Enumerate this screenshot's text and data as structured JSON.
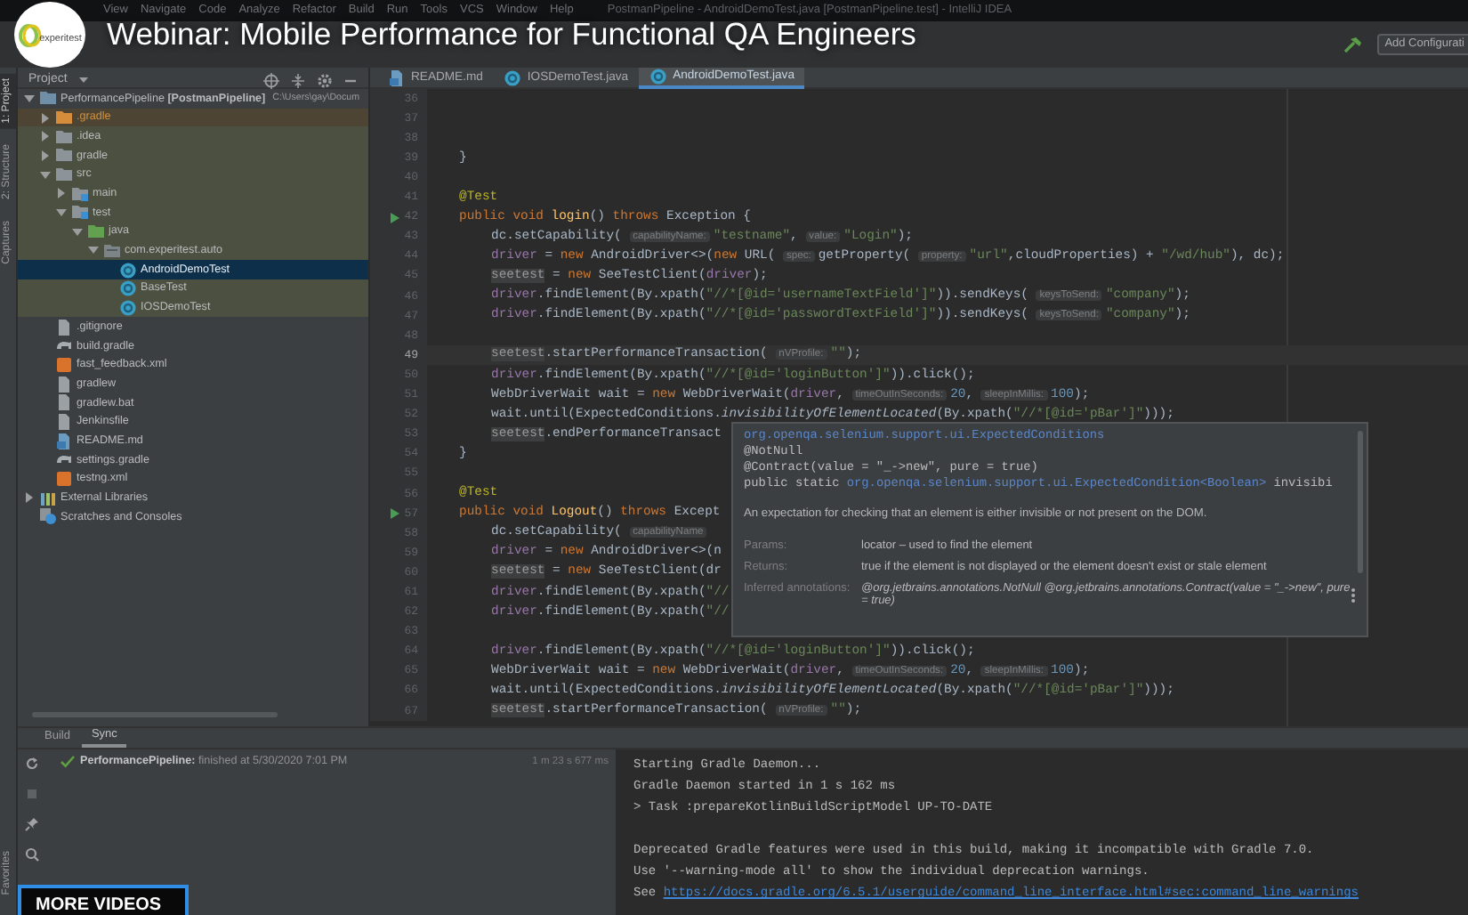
{
  "video_title": "Webinar: Mobile Performance for Functional QA Engineers",
  "channel_logo": {
    "text": "experitest"
  },
  "more_videos": "MORE VIDEOS",
  "ide": {
    "menu": [
      "View",
      "Navigate",
      "Code",
      "Analyze",
      "Refactor",
      "Build",
      "Run",
      "Tools",
      "VCS",
      "Window",
      "Help"
    ],
    "window_title": "PostmanPipeline - AndroidDemoTest.java [PostmanPipeline.test] - IntelliJ IDEA",
    "run_config": "Add Configurati",
    "side_tabs": [
      {
        "label": "1: Project",
        "selected": true
      },
      {
        "label": "2: Structure",
        "selected": false
      },
      {
        "label": "Captures",
        "selected": false
      }
    ],
    "bottom_side_tab": "Favorites",
    "project": {
      "title": "Project",
      "tree": [
        {
          "label": "PerformancePipeline **[PostmanPipeline]**",
          "path": "C:\\Users\\gay\\Docum",
          "kind": "module",
          "selected": false,
          "highlighted": false,
          "expanded": true,
          "children": [
            {
              "label": ".gradle",
              "kind": "excluded",
              "selected": false,
              "highlighted": true,
              "expanded": false
            },
            {
              "label": ".idea",
              "kind": "folder",
              "selected": false,
              "highlighted": true,
              "expanded": false
            },
            {
              "label": "gradle",
              "kind": "folder",
              "selected": false,
              "highlighted": true,
              "expanded": false
            },
            {
              "label": "src",
              "kind": "folder",
              "selected": false,
              "highlighted": true,
              "expanded": true,
              "children": [
                {
                  "label": "main",
                  "kind": "source",
                  "selected": false,
                  "highlighted": true,
                  "expanded": false
                },
                {
                  "label": "test",
                  "kind": "source",
                  "selected": false,
                  "highlighted": true,
                  "expanded": true,
                  "children": [
                    {
                      "label": "java",
                      "kind": "test-root",
                      "selected": false,
                      "highlighted": true,
                      "expanded": true,
                      "children": [
                        {
                          "label": "com.experitest.auto",
                          "kind": "package",
                          "selected": false,
                          "highlighted": true,
                          "expanded": true,
                          "children": [
                            {
                              "label": "AndroidDemoTest",
                              "kind": "class",
                              "selected": true,
                              "highlighted": true
                            },
                            {
                              "label": "BaseTest",
                              "kind": "class",
                              "selected": false,
                              "highlighted": true
                            },
                            {
                              "label": "IOSDemoTest",
                              "kind": "class",
                              "selected": false,
                              "highlighted": true
                            }
                          ]
                        }
                      ]
                    }
                  ]
                }
              ]
            },
            {
              "label": ".gitignore",
              "kind": "file",
              "selected": false,
              "highlighted": false
            },
            {
              "label": "build.gradle",
              "kind": "gradle",
              "selected": false,
              "highlighted": false
            },
            {
              "label": "fast_feedback.xml",
              "kind": "xml",
              "selected": false,
              "highlighted": false
            },
            {
              "label": "gradlew",
              "kind": "file",
              "selected": false,
              "highlighted": false
            },
            {
              "label": "gradlew.bat",
              "kind": "file",
              "selected": false,
              "highlighted": false
            },
            {
              "label": "Jenkinsfile",
              "kind": "file",
              "selected": false,
              "highlighted": false
            },
            {
              "label": "README.md",
              "kind": "markdown",
              "selected": false,
              "highlighted": false
            },
            {
              "label": "settings.gradle",
              "kind": "gradle",
              "selected": false,
              "highlighted": false
            },
            {
              "label": "testng.xml",
              "kind": "xml",
              "selected": false,
              "highlighted": false
            }
          ]
        },
        {
          "label": "External Libraries",
          "kind": "library",
          "selected": false,
          "highlighted": false,
          "expanded": false
        },
        {
          "label": "Scratches and Consoles",
          "kind": "scratch",
          "selected": false,
          "highlighted": false
        }
      ]
    },
    "tabs": [
      {
        "label": "README.md",
        "kind": "markdown",
        "selected": false
      },
      {
        "label": "IOSDemoTest.java",
        "kind": "class",
        "selected": false
      },
      {
        "label": "AndroidDemoTest.java",
        "kind": "class",
        "selected": true
      }
    ],
    "lines": [
      {
        "number": "36",
        "kind": "blank",
        "run_marker": false,
        "current": false
      },
      {
        "number": "37",
        "kind": "blank",
        "run_marker": false,
        "current": false
      },
      {
        "number": "38",
        "kind": "blank",
        "run_marker": false,
        "current": false
      },
      {
        "number": "39",
        "kind": "member",
        "run_marker": false,
        "current": false,
        "code": [
          {
            "kind": "plain",
            "text": "}"
          }
        ]
      },
      {
        "number": "40",
        "kind": "blank",
        "run_marker": false,
        "current": false
      },
      {
        "number": "41",
        "kind": "member",
        "run_marker": false,
        "current": false,
        "code": [
          {
            "kind": "annotation",
            "text": "@Test"
          }
        ]
      },
      {
        "number": "42",
        "kind": "member",
        "run_marker": true,
        "current": false,
        "code": [
          {
            "kind": "keyword",
            "text": "public void "
          },
          {
            "kind": "declaration",
            "text": "login"
          },
          {
            "kind": "plain",
            "text": "() "
          },
          {
            "kind": "keyword",
            "text": "throws "
          },
          {
            "kind": "plain",
            "text": "Exception {"
          }
        ]
      },
      {
        "number": "43",
        "kind": "statement",
        "run_marker": false,
        "current": false,
        "code": [
          {
            "kind": "plain",
            "text": "dc.setCapability( "
          },
          {
            "kind": "hint",
            "text": "capabilityName:"
          },
          {
            "kind": "string",
            "text": "\"testname\""
          },
          {
            "kind": "plain",
            "text": ", "
          },
          {
            "kind": "hint",
            "text": "value:"
          },
          {
            "kind": "string",
            "text": "\"Login\""
          },
          {
            "kind": "plain",
            "text": ");"
          }
        ]
      },
      {
        "number": "44",
        "kind": "statement",
        "run_marker": false,
        "current": false,
        "code": [
          {
            "kind": "field",
            "text": "driver"
          },
          {
            "kind": "plain",
            "text": " = "
          },
          {
            "kind": "keyword",
            "text": "new "
          },
          {
            "kind": "plain",
            "text": "AndroidDriver<>("
          },
          {
            "kind": "keyword",
            "text": "new "
          },
          {
            "kind": "plain",
            "text": "URL( "
          },
          {
            "kind": "hint",
            "text": "spec:"
          },
          {
            "kind": "plain",
            "text": "getProperty( "
          },
          {
            "kind": "hint",
            "text": "property:"
          },
          {
            "kind": "string",
            "text": "\"url\""
          },
          {
            "kind": "plain",
            "text": ",cloudProperties) + "
          },
          {
            "kind": "string",
            "text": "\"/wd/hub\""
          },
          {
            "kind": "plain",
            "text": "), dc);"
          }
        ]
      },
      {
        "number": "45",
        "kind": "statement",
        "run_marker": false,
        "current": false,
        "code": [
          {
            "kind": "unused",
            "text": "seetest"
          },
          {
            "kind": "plain",
            "text": " = "
          },
          {
            "kind": "keyword",
            "text": "new "
          },
          {
            "kind": "plain",
            "text": "SeeTestClient("
          },
          {
            "kind": "field",
            "text": "driver"
          },
          {
            "kind": "plain",
            "text": ");"
          }
        ]
      },
      {
        "number": "46",
        "kind": "statement",
        "run_marker": false,
        "current": false,
        "code": [
          {
            "kind": "field",
            "text": "driver"
          },
          {
            "kind": "plain",
            "text": ".findElement(By.xpath("
          },
          {
            "kind": "string",
            "text": "\"//*[@id='usernameTextField']\""
          },
          {
            "kind": "plain",
            "text": ")).sendKeys( "
          },
          {
            "kind": "hint",
            "text": "keysToSend:"
          },
          {
            "kind": "string",
            "text": "\"company\""
          },
          {
            "kind": "plain",
            "text": ");"
          }
        ]
      },
      {
        "number": "47",
        "kind": "statement",
        "run_marker": false,
        "current": false,
        "code": [
          {
            "kind": "field",
            "text": "driver"
          },
          {
            "kind": "plain",
            "text": ".findElement(By.xpath("
          },
          {
            "kind": "string",
            "text": "\"//*[@id='passwordTextField']\""
          },
          {
            "kind": "plain",
            "text": ")).sendKeys( "
          },
          {
            "kind": "hint",
            "text": "keysToSend:"
          },
          {
            "kind": "string",
            "text": "\"company\""
          },
          {
            "kind": "plain",
            "text": ");"
          }
        ]
      },
      {
        "number": "48",
        "kind": "blank",
        "run_marker": false,
        "current": false
      },
      {
        "number": "49",
        "kind": "statement",
        "run_marker": false,
        "current": true,
        "code": [
          {
            "kind": "unused",
            "text": "seetest"
          },
          {
            "kind": "plain",
            "text": ".startPerformanceTransaction( "
          },
          {
            "kind": "hint",
            "text": "nVProfile:"
          },
          {
            "kind": "string",
            "text": "\"\""
          },
          {
            "kind": "plain",
            "text": ");"
          }
        ]
      },
      {
        "number": "50",
        "kind": "statement",
        "run_marker": false,
        "current": false,
        "code": [
          {
            "kind": "field",
            "text": "driver"
          },
          {
            "kind": "plain",
            "text": ".findElement(By.xpath("
          },
          {
            "kind": "string",
            "text": "\"//*[@id='loginButton']\""
          },
          {
            "kind": "plain",
            "text": ")).click();"
          }
        ]
      },
      {
        "number": "51",
        "kind": "statement",
        "run_marker": false,
        "current": false,
        "code": [
          {
            "kind": "plain",
            "text": "WebDriverWait wait = "
          },
          {
            "kind": "keyword",
            "text": "new "
          },
          {
            "kind": "plain",
            "text": "WebDriverWait("
          },
          {
            "kind": "field",
            "text": "driver"
          },
          {
            "kind": "plain",
            "text": ", "
          },
          {
            "kind": "hint",
            "text": "timeOutInSeconds:"
          },
          {
            "kind": "number",
            "text": "20"
          },
          {
            "kind": "plain",
            "text": ", "
          },
          {
            "kind": "hint",
            "text": "sleepInMillis:"
          },
          {
            "kind": "number",
            "text": "100"
          },
          {
            "kind": "plain",
            "text": ");"
          }
        ]
      },
      {
        "number": "52",
        "kind": "statement",
        "run_marker": false,
        "current": false,
        "code": [
          {
            "kind": "plain",
            "text": "wait.until(ExpectedConditions."
          },
          {
            "kind": "static",
            "text": "invisibilityOfElementLocated"
          },
          {
            "kind": "plain",
            "text": "(By.xpath("
          },
          {
            "kind": "string",
            "text": "\"//*[@id='pBar']\""
          },
          {
            "kind": "plain",
            "text": ")));"
          }
        ]
      },
      {
        "number": "53",
        "kind": "statement",
        "run_marker": false,
        "current": false,
        "code": [
          {
            "kind": "unused",
            "text": "seetest"
          },
          {
            "kind": "plain",
            "text": ".endPerformanceTransact"
          }
        ]
      },
      {
        "number": "54",
        "kind": "member",
        "run_marker": false,
        "current": false,
        "code": [
          {
            "kind": "plain",
            "text": "}"
          }
        ]
      },
      {
        "number": "55",
        "kind": "blank",
        "run_marker": false,
        "current": false
      },
      {
        "number": "56",
        "kind": "member",
        "run_marker": false,
        "current": false,
        "code": [
          {
            "kind": "annotation",
            "text": "@Test"
          }
        ]
      },
      {
        "number": "57",
        "kind": "member",
        "run_marker": true,
        "current": false,
        "code": [
          {
            "kind": "keyword",
            "text": "public void "
          },
          {
            "kind": "declaration",
            "text": "Logout"
          },
          {
            "kind": "plain",
            "text": "() "
          },
          {
            "kind": "keyword",
            "text": "throws "
          },
          {
            "kind": "plain",
            "text": "Except"
          }
        ]
      },
      {
        "number": "58",
        "kind": "statement",
        "run_marker": false,
        "current": false,
        "code": [
          {
            "kind": "plain",
            "text": "dc.setCapability( "
          },
          {
            "kind": "hint",
            "text": "capabilityName"
          }
        ]
      },
      {
        "number": "59",
        "kind": "statement",
        "run_marker": false,
        "current": false,
        "code": [
          {
            "kind": "field",
            "text": "driver"
          },
          {
            "kind": "plain",
            "text": " = "
          },
          {
            "kind": "keyword",
            "text": "new "
          },
          {
            "kind": "plain",
            "text": "AndroidDriver<>(n"
          }
        ]
      },
      {
        "number": "60",
        "kind": "statement",
        "run_marker": false,
        "current": false,
        "code": [
          {
            "kind": "unused",
            "text": "seetest"
          },
          {
            "kind": "plain",
            "text": " = "
          },
          {
            "kind": "keyword",
            "text": "new "
          },
          {
            "kind": "plain",
            "text": "SeeTestClient(dr"
          }
        ]
      },
      {
        "number": "61",
        "kind": "statement",
        "run_marker": false,
        "current": false,
        "code": [
          {
            "kind": "field",
            "text": "driver"
          },
          {
            "kind": "plain",
            "text": ".findElement(By.xpath("
          },
          {
            "kind": "string",
            "text": "\"//"
          }
        ]
      },
      {
        "number": "62",
        "kind": "statement",
        "run_marker": false,
        "current": false,
        "code": [
          {
            "kind": "field",
            "text": "driver"
          },
          {
            "kind": "plain",
            "text": ".findElement(By.xpath("
          },
          {
            "kind": "string",
            "text": "\"//"
          }
        ]
      },
      {
        "number": "63",
        "kind": "blank",
        "run_marker": false,
        "current": false
      },
      {
        "number": "64",
        "kind": "statement",
        "run_marker": false,
        "current": false,
        "code": [
          {
            "kind": "field",
            "text": "driver"
          },
          {
            "kind": "plain",
            "text": ".findElement(By.xpath("
          },
          {
            "kind": "string",
            "text": "\"//*[@id='loginButton']\""
          },
          {
            "kind": "plain",
            "text": ")).click();"
          }
        ]
      },
      {
        "number": "65",
        "kind": "statement",
        "run_marker": false,
        "current": false,
        "code": [
          {
            "kind": "plain",
            "text": "WebDriverWait wait = "
          },
          {
            "kind": "keyword",
            "text": "new "
          },
          {
            "kind": "plain",
            "text": "WebDriverWait("
          },
          {
            "kind": "field",
            "text": "driver"
          },
          {
            "kind": "plain",
            "text": ", "
          },
          {
            "kind": "hint",
            "text": "timeOutInSeconds:"
          },
          {
            "kind": "number",
            "text": "20"
          },
          {
            "kind": "plain",
            "text": ", "
          },
          {
            "kind": "hint",
            "text": "sleepInMillis:"
          },
          {
            "kind": "number",
            "text": "100"
          },
          {
            "kind": "plain",
            "text": ");"
          }
        ]
      },
      {
        "number": "66",
        "kind": "statement",
        "run_marker": false,
        "current": false,
        "code": [
          {
            "kind": "plain",
            "text": "wait.until(ExpectedConditions."
          },
          {
            "kind": "static",
            "text": "invisibilityOfElementLocated"
          },
          {
            "kind": "plain",
            "text": "(By.xpath("
          },
          {
            "kind": "string",
            "text": "\"//*[@id='pBar']\""
          },
          {
            "kind": "plain",
            "text": ")));"
          }
        ]
      },
      {
        "number": "67",
        "kind": "statement",
        "run_marker": false,
        "current": false,
        "code": [
          {
            "kind": "unused",
            "text": "seetest"
          },
          {
            "kind": "plain",
            "text": ".startPerformanceTransaction( "
          },
          {
            "kind": "hint",
            "text": "nVProfile:"
          },
          {
            "kind": "string",
            "text": "\"\""
          },
          {
            "kind": "plain",
            "text": ");"
          }
        ]
      }
    ],
    "quick_doc": {
      "class_link": "org.openqa.selenium.support.ui.ExpectedConditions",
      "annotations": [
        "@NotNull",
        "@Contract(value = \"_->new\", pure = true)"
      ],
      "declaration": {
        "prefix": "public static ",
        "type": "org.openqa.selenium.support.ui.ExpectedCondition<Boolean>",
        "suffix": " invisibi"
      },
      "description": "An expectation for checking that an element is either invisible or not present on the DOM.",
      "sections": [
        {
          "label": "Params:",
          "value": "locator – used to find the element"
        },
        {
          "label": "Returns:",
          "value": "true if the element is not displayed or the element doesn't exist or stale element"
        },
        {
          "label": "Inferred annotations:",
          "value": "@org.jetbrains.annotations.NotNull @org.jetbrains.annotations.Contract(value = \"_->new\", pure = true)"
        }
      ]
    },
    "bottom_panel": {
      "tabs": [
        {
          "label": "Build",
          "selected": false
        },
        {
          "label": "Sync",
          "selected": true
        }
      ],
      "build_result": {
        "success": true,
        "name": "PerformancePipeline:",
        "detail": " finished at 5/30/2020 7:01 PM",
        "duration": "1 m 23 s 677 ms"
      },
      "console": [
        [
          {
            "text": "Starting Gradle Daemon..."
          },
          {
            "text": "Gradle Daemon started in 1 s 162 ms"
          },
          {
            "text": "> Task :prepareKotlinBuildScriptModel UP-TO-DATE"
          }
        ],
        [
          {
            "text": "Deprecated Gradle features were used in this build, making it incompatible with Gradle 7.0."
          },
          {
            "text": "Use '--warning-mode all' to show the individual deprecation warnings."
          },
          {
            "text": "See ",
            "link": "https://docs.gradle.org/6.5.1/userguide/command_line_interface.html#sec:command_line_warnings"
          }
        ]
      ]
    }
  }
}
